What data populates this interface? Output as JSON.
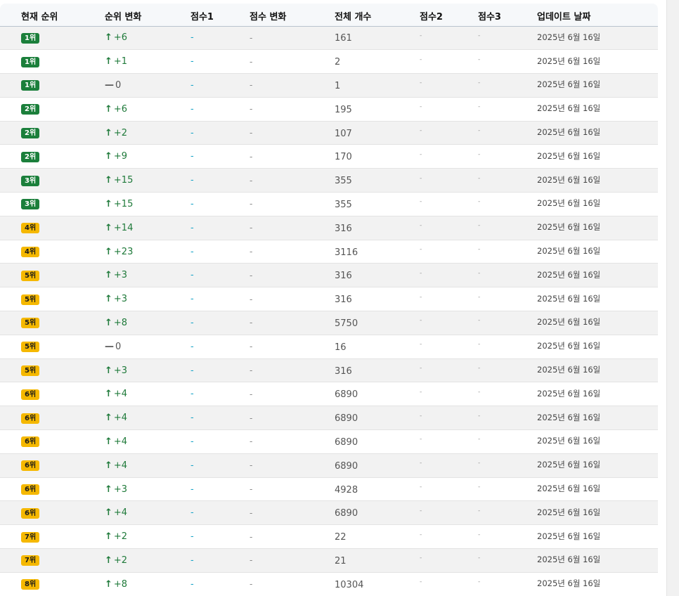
{
  "table": {
    "headers": [
      "현재 순위",
      "순위 변화",
      "점수1",
      "점수 변화",
      "전체 개수",
      "점수2",
      "점수3",
      "업데이트 날짜"
    ],
    "rows": [
      {
        "rank": "1위",
        "rank_color": "green",
        "change_dir": "up",
        "change": "+6",
        "score1": "-",
        "score_change": "-",
        "total": "161",
        "score2": "-",
        "score3": "-",
        "date": "2025년 6월 16일"
      },
      {
        "rank": "1위",
        "rank_color": "green",
        "change_dir": "up",
        "change": "+1",
        "score1": "-",
        "score_change": "-",
        "total": "2",
        "score2": "-",
        "score3": "-",
        "date": "2025년 6월 16일"
      },
      {
        "rank": "1위",
        "rank_color": "green",
        "change_dir": "none",
        "change": "0",
        "score1": "-",
        "score_change": "-",
        "total": "1",
        "score2": "-",
        "score3": "-",
        "date": "2025년 6월 16일"
      },
      {
        "rank": "2위",
        "rank_color": "green",
        "change_dir": "up",
        "change": "+6",
        "score1": "-",
        "score_change": "-",
        "total": "195",
        "score2": "-",
        "score3": "-",
        "date": "2025년 6월 16일"
      },
      {
        "rank": "2위",
        "rank_color": "green",
        "change_dir": "up",
        "change": "+2",
        "score1": "-",
        "score_change": "-",
        "total": "107",
        "score2": "-",
        "score3": "-",
        "date": "2025년 6월 16일"
      },
      {
        "rank": "2위",
        "rank_color": "green",
        "change_dir": "up",
        "change": "+9",
        "score1": "-",
        "score_change": "-",
        "total": "170",
        "score2": "-",
        "score3": "-",
        "date": "2025년 6월 16일"
      },
      {
        "rank": "3위",
        "rank_color": "green",
        "change_dir": "up",
        "change": "+15",
        "score1": "-",
        "score_change": "-",
        "total": "355",
        "score2": "-",
        "score3": "-",
        "date": "2025년 6월 16일"
      },
      {
        "rank": "3위",
        "rank_color": "green",
        "change_dir": "up",
        "change": "+15",
        "score1": "-",
        "score_change": "-",
        "total": "355",
        "score2": "-",
        "score3": "-",
        "date": "2025년 6월 16일"
      },
      {
        "rank": "4위",
        "rank_color": "yellow",
        "change_dir": "up",
        "change": "+14",
        "score1": "-",
        "score_change": "-",
        "total": "316",
        "score2": "-",
        "score3": "-",
        "date": "2025년 6월 16일"
      },
      {
        "rank": "4위",
        "rank_color": "yellow",
        "change_dir": "up",
        "change": "+23",
        "score1": "-",
        "score_change": "-",
        "total": "3116",
        "score2": "-",
        "score3": "-",
        "date": "2025년 6월 16일"
      },
      {
        "rank": "5위",
        "rank_color": "yellow",
        "change_dir": "up",
        "change": "+3",
        "score1": "-",
        "score_change": "-",
        "total": "316",
        "score2": "-",
        "score3": "-",
        "date": "2025년 6월 16일"
      },
      {
        "rank": "5위",
        "rank_color": "yellow",
        "change_dir": "up",
        "change": "+3",
        "score1": "-",
        "score_change": "-",
        "total": "316",
        "score2": "-",
        "score3": "-",
        "date": "2025년 6월 16일"
      },
      {
        "rank": "5위",
        "rank_color": "yellow",
        "change_dir": "up",
        "change": "+8",
        "score1": "-",
        "score_change": "-",
        "total": "5750",
        "score2": "-",
        "score3": "-",
        "date": "2025년 6월 16일"
      },
      {
        "rank": "5위",
        "rank_color": "yellow",
        "change_dir": "none",
        "change": "0",
        "score1": "-",
        "score_change": "-",
        "total": "16",
        "score2": "-",
        "score3": "-",
        "date": "2025년 6월 16일"
      },
      {
        "rank": "5위",
        "rank_color": "yellow",
        "change_dir": "up",
        "change": "+3",
        "score1": "-",
        "score_change": "-",
        "total": "316",
        "score2": "-",
        "score3": "-",
        "date": "2025년 6월 16일"
      },
      {
        "rank": "6위",
        "rank_color": "yellow",
        "change_dir": "up",
        "change": "+4",
        "score1": "-",
        "score_change": "-",
        "total": "6890",
        "score2": "-",
        "score3": "-",
        "date": "2025년 6월 16일"
      },
      {
        "rank": "6위",
        "rank_color": "yellow",
        "change_dir": "up",
        "change": "+4",
        "score1": "-",
        "score_change": "-",
        "total": "6890",
        "score2": "-",
        "score3": "-",
        "date": "2025년 6월 16일"
      },
      {
        "rank": "6위",
        "rank_color": "yellow",
        "change_dir": "up",
        "change": "+4",
        "score1": "-",
        "score_change": "-",
        "total": "6890",
        "score2": "-",
        "score3": "-",
        "date": "2025년 6월 16일"
      },
      {
        "rank": "6위",
        "rank_color": "yellow",
        "change_dir": "up",
        "change": "+4",
        "score1": "-",
        "score_change": "-",
        "total": "6890",
        "score2": "-",
        "score3": "-",
        "date": "2025년 6월 16일"
      },
      {
        "rank": "6위",
        "rank_color": "yellow",
        "change_dir": "up",
        "change": "+3",
        "score1": "-",
        "score_change": "-",
        "total": "4928",
        "score2": "-",
        "score3": "-",
        "date": "2025년 6월 16일"
      },
      {
        "rank": "6위",
        "rank_color": "yellow",
        "change_dir": "up",
        "change": "+4",
        "score1": "-",
        "score_change": "-",
        "total": "6890",
        "score2": "-",
        "score3": "-",
        "date": "2025년 6월 16일"
      },
      {
        "rank": "7위",
        "rank_color": "yellow",
        "change_dir": "up",
        "change": "+2",
        "score1": "-",
        "score_change": "-",
        "total": "22",
        "score2": "-",
        "score3": "-",
        "date": "2025년 6월 16일"
      },
      {
        "rank": "7위",
        "rank_color": "yellow",
        "change_dir": "up",
        "change": "+2",
        "score1": "-",
        "score_change": "-",
        "total": "21",
        "score2": "-",
        "score3": "-",
        "date": "2025년 6월 16일"
      },
      {
        "rank": "8위",
        "rank_color": "yellow",
        "change_dir": "up",
        "change": "+8",
        "score1": "-",
        "score_change": "-",
        "total": "10304",
        "score2": "-",
        "score3": "-",
        "date": "2025년 6월 16일"
      }
    ]
  },
  "colors": {
    "rank_green": "#1b7f3b",
    "rank_yellow": "#f5b800",
    "change_up": "#1f7a3a",
    "score1_dash": "#1aa5c8"
  },
  "icons": {
    "up": "arrow-up-icon",
    "none": "dash-icon"
  }
}
